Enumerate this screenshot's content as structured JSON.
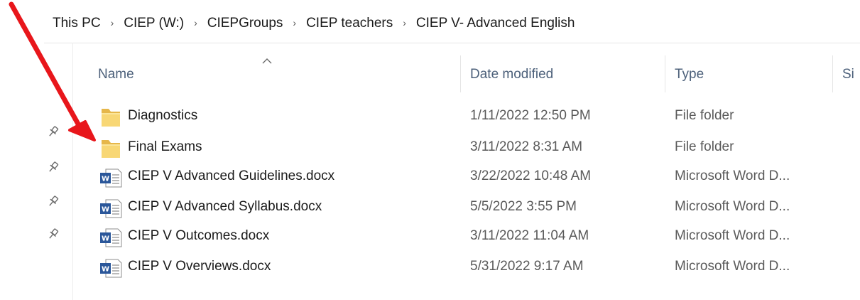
{
  "breadcrumb": {
    "items": [
      "This PC",
      "CIEP (W:)",
      "CIEPGroups",
      "CIEP teachers",
      "CIEP V- Advanced English"
    ],
    "separator": "›"
  },
  "columns": {
    "name": "Name",
    "date_modified": "Date modified",
    "type": "Type",
    "size": "Si"
  },
  "sort": {
    "column": "name",
    "direction": "ascending"
  },
  "files": [
    {
      "name": "Diagnostics",
      "date": "1/11/2022 12:50 PM",
      "type": "File folder",
      "icon": "folder-icon"
    },
    {
      "name": "Final Exams",
      "date": "3/11/2022 8:31 AM",
      "type": "File folder",
      "icon": "folder-icon"
    },
    {
      "name": "CIEP V Advanced Guidelines.docx",
      "date": "3/22/2022 10:48 AM",
      "type": "Microsoft Word D...",
      "icon": "word-document-icon"
    },
    {
      "name": "CIEP V Advanced Syllabus.docx",
      "date": "5/5/2022 3:55 PM",
      "type": "Microsoft Word D...",
      "icon": "word-document-icon"
    },
    {
      "name": "CIEP V Outcomes.docx",
      "date": "3/11/2022 11:04 AM",
      "type": "Microsoft Word D...",
      "icon": "word-document-icon"
    },
    {
      "name": "CIEP V Overviews.docx",
      "date": "5/31/2022 9:17 AM",
      "type": "Microsoft Word D...",
      "icon": "word-document-icon"
    }
  ],
  "colors": {
    "folder": "#f8d775",
    "folder_dark": "#e6b74a",
    "word_blue": "#2b579a",
    "header_text": "#4c607a",
    "annotation_arrow": "#e8161b"
  }
}
